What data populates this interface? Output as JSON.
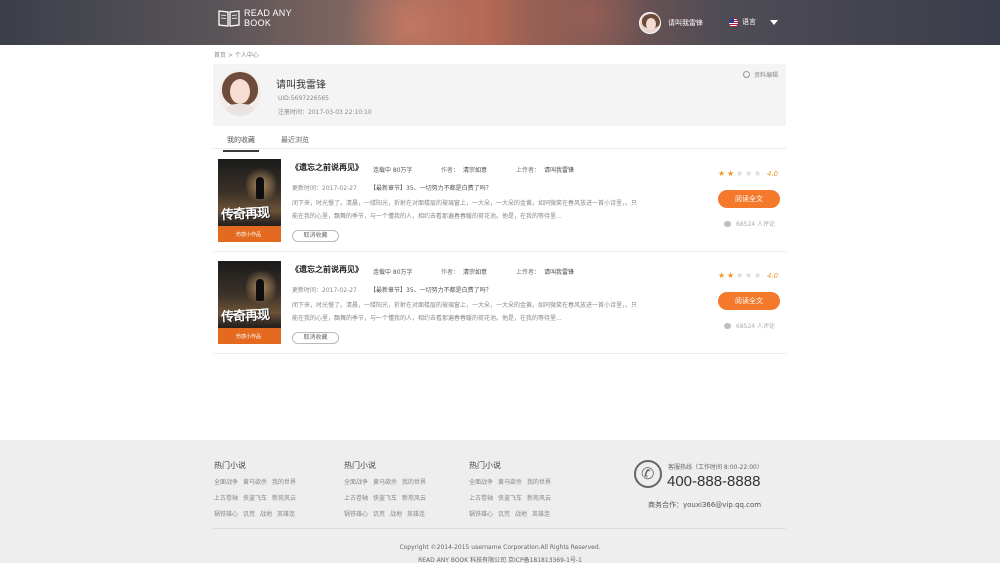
{
  "header": {
    "logo_line1": "READ ANY",
    "logo_line2": "BOOK",
    "username": "请叫我雷锋",
    "language": "语言"
  },
  "breadcrumb": "首页 > 个人中心",
  "profile": {
    "name": "请叫我雷锋",
    "uid": "UID:5697226565",
    "register_time": "注册时间：2017-03-03   22:10:10",
    "edit_label": "资料编辑"
  },
  "tabs": [
    {
      "label": "我的收藏",
      "active": true
    },
    {
      "label": "最近浏览",
      "active": false
    }
  ],
  "books": [
    {
      "title": "《遗忘之前说再见》",
      "status": "连载中   80万字",
      "author_label": "作者：",
      "author": "清宗如意",
      "uploader_label": "上传者：",
      "uploader": "请叫我雷锋",
      "update": "更新时间：2017-02-27",
      "chapter": "【最新章节】35、一切努力不都是白费了吗？",
      "desc": "闭下来，时光慢了。清晨，一缕阳光，折射在对面楼层的玻璃窗上，一大朵，一大朵的金黄。如同微笑在春风放进一首小诗里，。只能在我的心里，飘舞的季节，与一个懂我的人，相约去看那遍春春暖的荷花池。他是，在我的等待里...",
      "cancel_label": "取消收藏",
      "cover_art": "传奇再现",
      "cover_band": "伤感小作品",
      "stars_filled": 2,
      "stars_total": 5,
      "rating": "4.0",
      "read_label": "阅读全文",
      "comments": "68524 人评论"
    },
    {
      "title": "《遗忘之前说再见》",
      "status": "连载中   80万字",
      "author_label": "作者：",
      "author": "清宗如意",
      "uploader_label": "上传者：",
      "uploader": "请叫我雷锋",
      "update": "更新时间：2017-02-27",
      "chapter": "【最新章节】35、一切努力不都是白费了吗？",
      "desc": "闭下来，时光慢了。清晨，一缕阳光，折射在对面楼层的玻璃窗上，一大朵，一大朵的金黄。如同微笑在春风放进一首小诗里，。只能在我的心里，飘舞的季节，与一个懂我的人，相约去看那遍春春暖的荷花池。他是，在我的等待里...",
      "cancel_label": "取消收藏",
      "cover_art": "传奇再现",
      "cover_band": "伤感小作品",
      "stars_filled": 2,
      "stars_total": 5,
      "rating": "4.0",
      "read_label": "阅读全文",
      "comments": "68524 人评论"
    }
  ],
  "footer": {
    "columns": [
      {
        "title": "热门小说",
        "rows": [
          [
            "全面战争",
            "黄马欲杀",
            "我的世界"
          ],
          [
            "上古卷轴",
            "侠盗飞车",
            "新苑风云"
          ],
          [
            "锅铁雄心",
            "饥荒",
            "战地",
            "英雄连"
          ]
        ]
      },
      {
        "title": "热门小说",
        "rows": [
          [
            "全面战争",
            "黄马欲杀",
            "我的世界"
          ],
          [
            "上古卷轴",
            "侠盗飞车",
            "新苑风云"
          ],
          [
            "锅铁雄心",
            "饥荒",
            "战地",
            "英雄连"
          ]
        ]
      },
      {
        "title": "热门小说",
        "rows": [
          [
            "全面战争",
            "黄马欲杀",
            "我的世界"
          ],
          [
            "上古卷轴",
            "侠盗飞车",
            "新苑风云"
          ],
          [
            "锅铁雄心",
            "饥荒",
            "战地",
            "英雄连"
          ]
        ]
      }
    ],
    "hotline_label": "客服热线（工作时间 8:00-22:00）",
    "hotline_number": "400-888-8888",
    "business": "商务合作：youxi366@vip.qq.com",
    "copyright": "Copyright ©2014-2015 username Corporation.All Rights Reserved.",
    "icp": "READ ANY BOOK 科技有限公司  京ICP备181813369-1号-1"
  },
  "colors": {
    "accent": "#f4792b",
    "star": "#f0961e",
    "footer_bg": "#eeeeee"
  },
  "icons": [
    "book-logo-icon",
    "avatar",
    "flag-icon",
    "chevron-down-icon",
    "gear-icon",
    "star-icon",
    "comment-icon",
    "phone-icon"
  ]
}
